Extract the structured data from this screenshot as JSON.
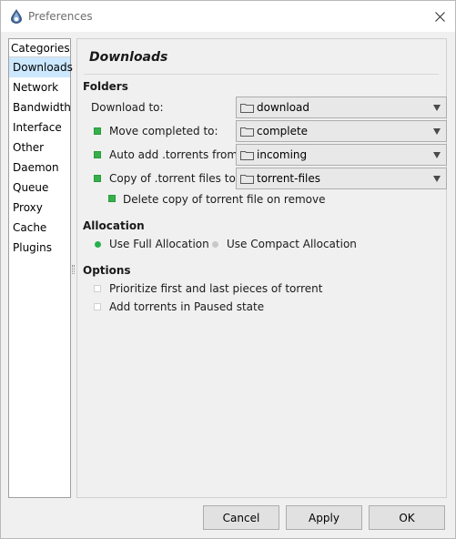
{
  "window": {
    "title": "Preferences"
  },
  "sidebar": {
    "header": "Categories",
    "items": [
      {
        "label": "Downloads",
        "selected": true
      },
      {
        "label": "Network"
      },
      {
        "label": "Bandwidth"
      },
      {
        "label": "Interface"
      },
      {
        "label": "Other"
      },
      {
        "label": "Daemon"
      },
      {
        "label": "Queue"
      },
      {
        "label": "Proxy"
      },
      {
        "label": "Cache"
      },
      {
        "label": "Plugins"
      }
    ]
  },
  "main": {
    "title": "Downloads",
    "folders": {
      "heading": "Folders",
      "download_to": {
        "label": "Download to:",
        "value": "download"
      },
      "move_completed": {
        "label": "Move completed to:",
        "value": "complete",
        "checked": true
      },
      "auto_add": {
        "label": "Auto add .torrents from:",
        "value": "incoming",
        "checked": true
      },
      "copy_torrent": {
        "label": "Copy of .torrent files to:",
        "value": "torrent-files",
        "checked": true
      },
      "delete_copy": {
        "label": "Delete copy of torrent file on remove",
        "checked": true
      }
    },
    "allocation": {
      "heading": "Allocation",
      "full": {
        "label": "Use Full Allocation",
        "selected": true
      },
      "compact": {
        "label": "Use Compact Allocation",
        "selected": false
      }
    },
    "options": {
      "heading": "Options",
      "prioritize": {
        "label": "Prioritize first and last pieces of torrent",
        "checked": false
      },
      "paused": {
        "label": "Add torrents in Paused state",
        "checked": false
      }
    }
  },
  "buttons": {
    "cancel": "Cancel",
    "apply": "Apply",
    "ok": "OK"
  },
  "colors": {
    "selection": "#cce8ff",
    "check_green": "#36b04a",
    "radio_green": "#27b04b"
  }
}
